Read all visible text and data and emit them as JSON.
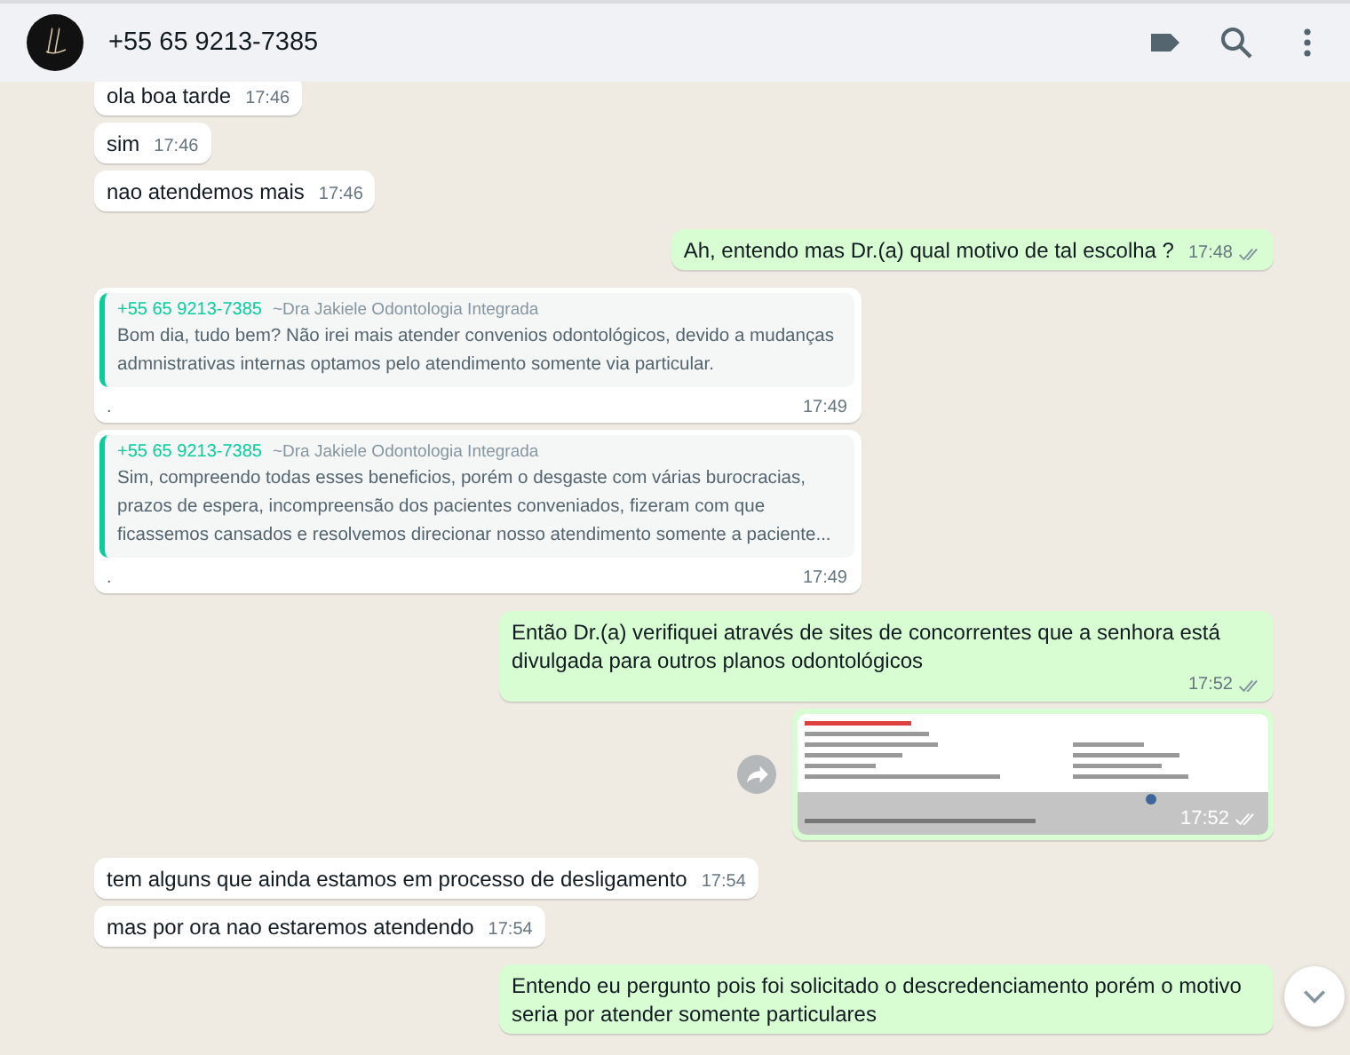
{
  "header": {
    "title": "+55 65 9213-7385"
  },
  "messages": [
    {
      "kind": "text",
      "outgoing": false,
      "text": "ola boa tarde",
      "time": "17:46"
    },
    {
      "kind": "text",
      "outgoing": false,
      "text": "sim",
      "time": "17:46"
    },
    {
      "kind": "text",
      "outgoing": false,
      "text": "nao atendemos mais",
      "time": "17:46"
    },
    {
      "kind": "text",
      "outgoing": true,
      "text": "Ah, entendo mas Dr.(a) qual motivo de tal escolha ?",
      "time": "17:48",
      "read": false
    },
    {
      "kind": "reply",
      "outgoing": false,
      "quote": {
        "sender": "+55 65 9213-7385",
        "name": "~Dra Jakiele Odontologia Integrada",
        "text": "Bom dia, tudo bem? Não irei mais atender convenios odontológicos, devido a mudanças admnistrativas internas optamos pelo atendimento somente via particular."
      },
      "text": ".",
      "time": "17:49"
    },
    {
      "kind": "reply",
      "outgoing": false,
      "quote": {
        "sender": "+55 65 9213-7385",
        "name": "~Dra Jakiele Odontologia Integrada",
        "text": "Sim, compreendo todas esses beneficios, porém o desgaste com várias burocracias, prazos de espera, incompreensão dos pacientes conveniados, fizeram com que ficassemos cansados e resolvemos direcionar nosso atendimento somente a paciente..."
      },
      "text": ".",
      "time": "17:49"
    },
    {
      "kind": "text",
      "outgoing": true,
      "text": "Então Dr.(a) verifiquei através de sites de concorrentes que a senhora está divulgada para outros planos odontológicos",
      "time": "17:52",
      "read": false
    },
    {
      "outgoing": true,
      "time": "17:52",
      "read": false
    },
    {
      "kind": "text",
      "outgoing": false,
      "text": "tem alguns que ainda estamos em processo de desligamento",
      "time": "17:54"
    },
    {
      "kind": "text",
      "outgoing": false,
      "text": "mas por ora nao estaremos atendendo",
      "time": "17:54"
    },
    {
      "kind": "text",
      "outgoing": true,
      "text": "Entendo eu pergunto pois foi solicitado o descredenciamento porém o motivo seria por atender somente particulares"
    }
  ]
}
